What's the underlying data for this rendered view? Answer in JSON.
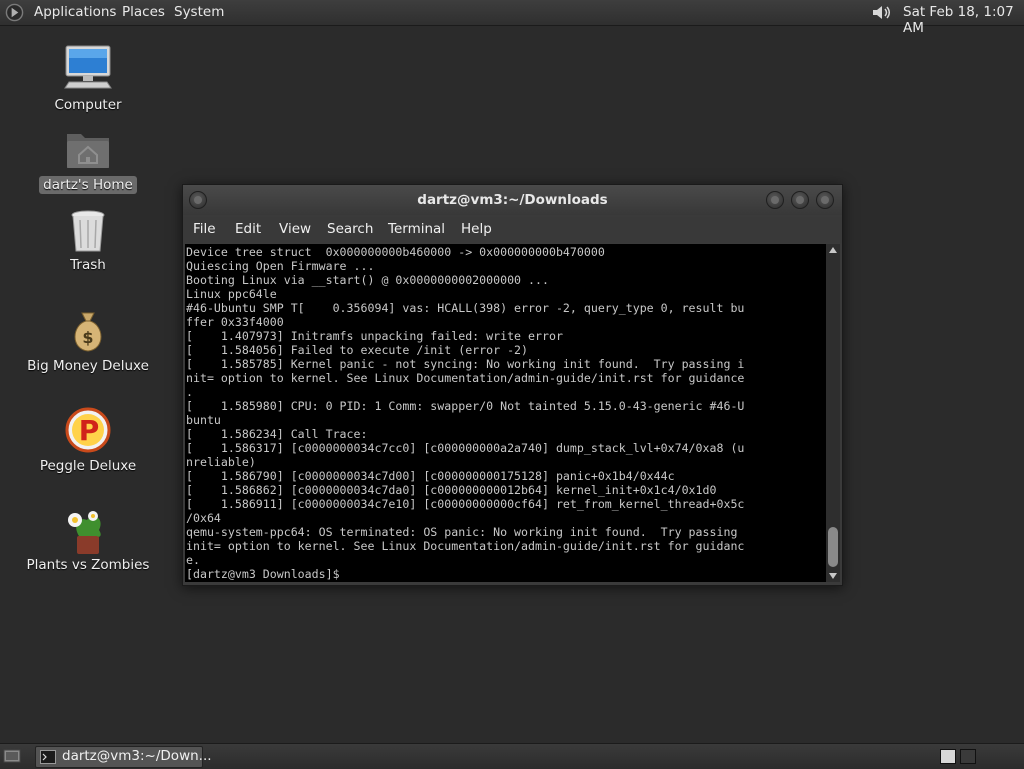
{
  "top_panel": {
    "menus": [
      "Applications",
      "Places",
      "System"
    ],
    "clock": "Sat Feb 18,  1:07 AM"
  },
  "desktop_icons": [
    {
      "label": "Computer",
      "icon": "computer-icon"
    },
    {
      "label": "dartz's Home",
      "icon": "home-folder-icon",
      "selected": true
    },
    {
      "label": "Trash",
      "icon": "trash-icon"
    },
    {
      "label": "Big Money Deluxe",
      "icon": "money-bag-icon"
    },
    {
      "label": "Peggle Deluxe",
      "icon": "peggle-icon"
    },
    {
      "label": "Plants vs Zombies",
      "icon": "plants-vs-zombies-icon"
    }
  ],
  "terminal": {
    "title": "dartz@vm3:~/Downloads",
    "menu": [
      "File",
      "Edit",
      "View",
      "Search",
      "Terminal",
      "Help"
    ],
    "lines": [
      "Device tree struct  0x000000000b460000 -> 0x000000000b470000",
      "Quiescing Open Firmware ...",
      "Booting Linux via __start() @ 0x0000000002000000 ...",
      "Linux ppc64le",
      "#46-Ubuntu SMP T[    0.356094] vas: HCALL(398) error -2, query_type 0, result bu",
      "ffer 0x33f4000",
      "[    1.407973] Initramfs unpacking failed: write error",
      "[    1.584056] Failed to execute /init (error -2)",
      "[    1.585785] Kernel panic - not syncing: No working init found.  Try passing i",
      "nit= option to kernel. See Linux Documentation/admin-guide/init.rst for guidance",
      ".",
      "[    1.585980] CPU: 0 PID: 1 Comm: swapper/0 Not tainted 5.15.0-43-generic #46-U",
      "buntu",
      "[    1.586234] Call Trace:",
      "[    1.586317] [c0000000034c7cc0] [c000000000a2a740] dump_stack_lvl+0x74/0xa8 (u",
      "nreliable)",
      "[    1.586790] [c0000000034c7d00] [c000000000175128] panic+0x1b4/0x44c",
      "[    1.586862] [c0000000034c7da0] [c000000000012b64] kernel_init+0x1c4/0x1d0",
      "[    1.586911] [c0000000034c7e10] [c00000000000cf64] ret_from_kernel_thread+0x5c",
      "/0x64",
      "qemu-system-ppc64: OS terminated: OS panic: No working init found.  Try passing",
      "init= option to kernel. See Linux Documentation/admin-guide/init.rst for guidanc",
      "e.",
      "[dartz@vm3 Downloads]$ "
    ]
  },
  "taskbar": {
    "task_label": "dartz@vm3:~/Down..."
  },
  "colors": {
    "desktop_bg": "#2b2b2b",
    "terminal_bg": "#000000",
    "terminal_fg": "#c8c8c8"
  }
}
